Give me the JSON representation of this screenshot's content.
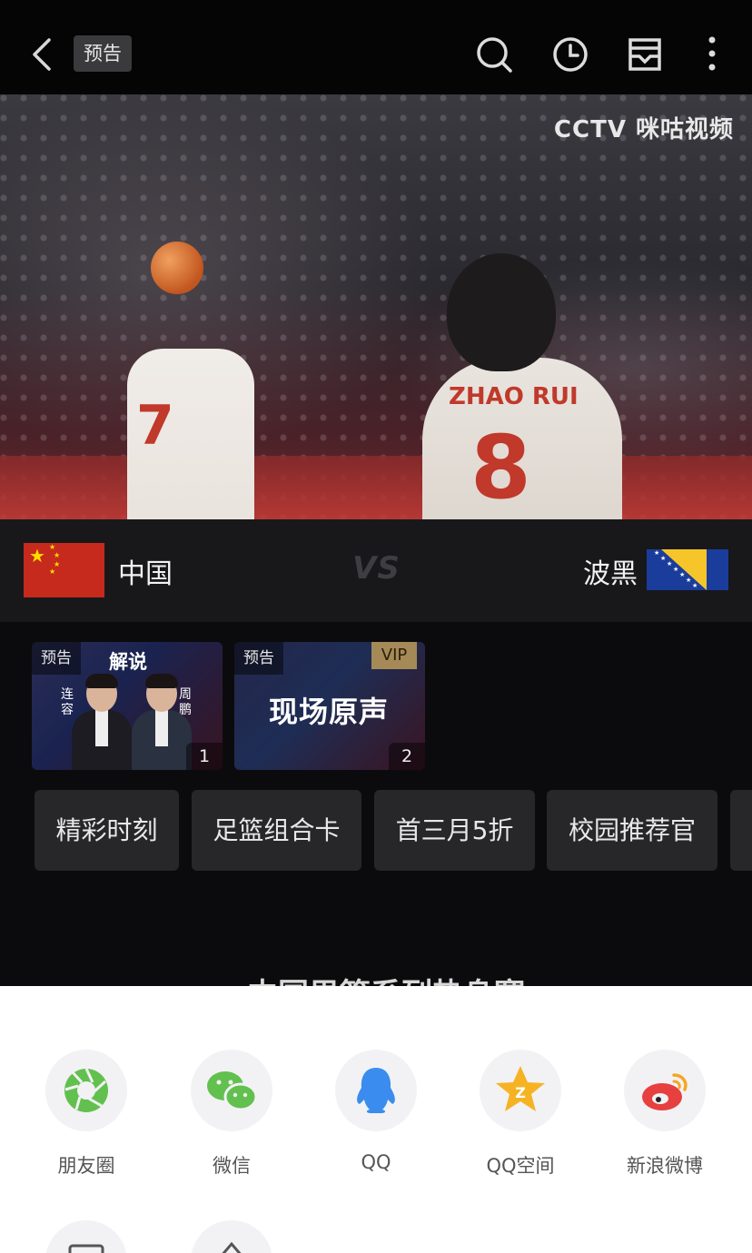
{
  "topbar": {
    "tag": "预告",
    "icons": [
      "back-icon",
      "search-icon",
      "clock-icon",
      "inbox-icon",
      "more-icon"
    ]
  },
  "video": {
    "watermark": "CCTV 咪咕视频",
    "player1_number": "7",
    "player2_name": "ZHAO RUI",
    "player2_number": "8"
  },
  "match": {
    "home": "中国",
    "vs": "VS",
    "away": "波黑"
  },
  "cards": [
    {
      "tag": "预告",
      "title": "解说",
      "name_left": "连容",
      "name_right": "周鹏",
      "num": "1"
    },
    {
      "tag": "预告",
      "vip": "VIP",
      "title": "现场原声",
      "num": "2"
    }
  ],
  "chips": [
    "精彩时刻",
    "足篮组合卡",
    "首三月5折",
    "校园推荐官"
  ],
  "section_peek": "中国男篮系列热身赛",
  "share": [
    {
      "label": "朋友圈",
      "icon": "moments-icon",
      "color": "#5fbf4c"
    },
    {
      "label": "微信",
      "icon": "wechat-icon",
      "color": "#5fbf4c"
    },
    {
      "label": "QQ",
      "icon": "qq-icon",
      "color": "#3a8dee"
    },
    {
      "label": "QQ空间",
      "icon": "qzone-icon",
      "color": "#f5b324"
    },
    {
      "label": "新浪微博",
      "icon": "weibo-icon",
      "color": "#e6403f"
    }
  ]
}
